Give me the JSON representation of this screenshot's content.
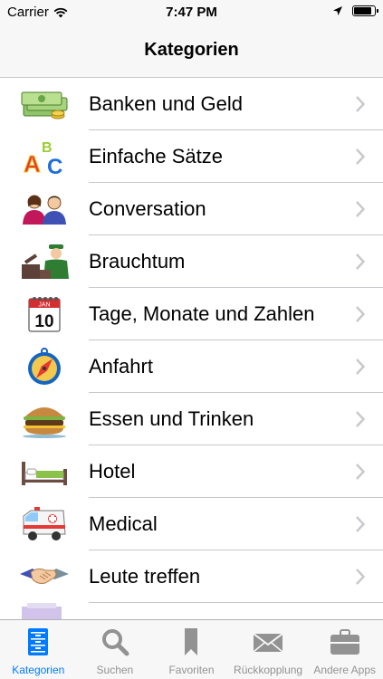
{
  "status": {
    "carrier": "Carrier",
    "time": "7:47 PM"
  },
  "nav": {
    "title": "Kategorien"
  },
  "categories": [
    {
      "label": "Banken und Geld",
      "icon": "money-icon"
    },
    {
      "label": "Einfache Sätze",
      "icon": "abc-icon"
    },
    {
      "label": "Conversation",
      "icon": "people-icon"
    },
    {
      "label": "Brauchtum",
      "icon": "customs-officer-icon"
    },
    {
      "label": "Tage, Monate und Zahlen",
      "icon": "calendar-icon"
    },
    {
      "label": "Anfahrt",
      "icon": "compass-icon"
    },
    {
      "label": "Essen und Trinken",
      "icon": "burger-icon"
    },
    {
      "label": "Hotel",
      "icon": "bed-icon"
    },
    {
      "label": "Medical",
      "icon": "ambulance-icon"
    },
    {
      "label": "Leute treffen",
      "icon": "handshake-icon"
    }
  ],
  "calendar_icon": {
    "month": "JAN",
    "day": "10"
  },
  "tabs": [
    {
      "label": "Kategorien",
      "icon": "cabinet-icon",
      "active": true
    },
    {
      "label": "Suchen",
      "icon": "search-icon",
      "active": false
    },
    {
      "label": "Favoriten",
      "icon": "bookmark-icon",
      "active": false
    },
    {
      "label": "Rückkopplung",
      "icon": "envelope-icon",
      "active": false
    },
    {
      "label": "Andere Apps",
      "icon": "briefcase-icon",
      "active": false
    }
  ],
  "colors": {
    "accent": "#007aff",
    "inactive": "#929292",
    "separator": "#c8c7cc",
    "chevron": "#c7c7cc"
  }
}
